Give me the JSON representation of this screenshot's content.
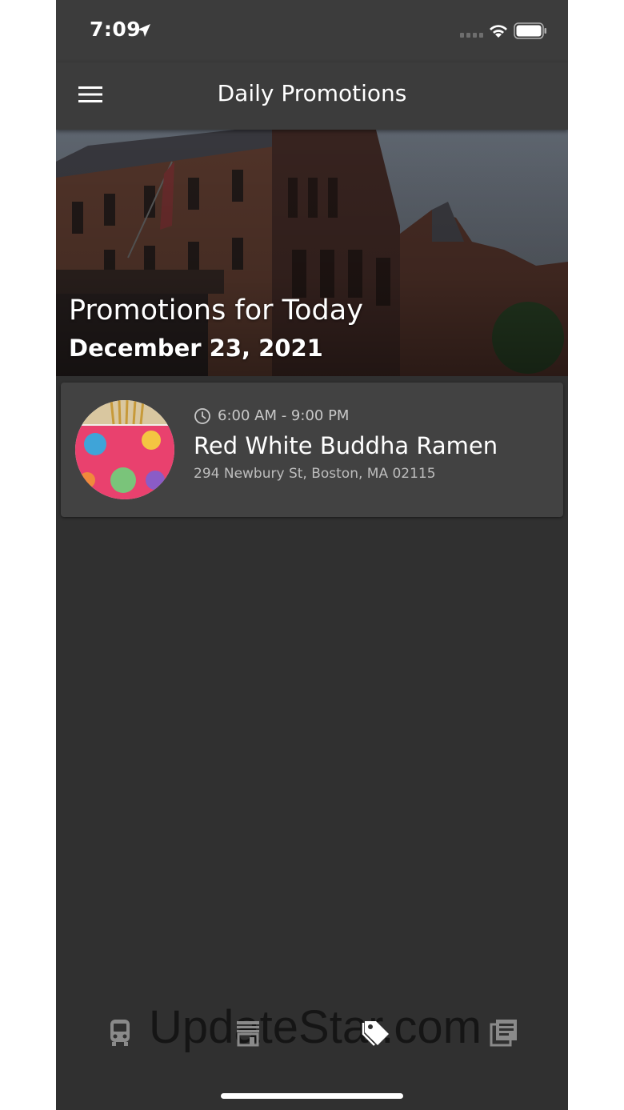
{
  "status_bar": {
    "time": "7:09",
    "location_icon": "location-arrow-icon",
    "signal_icon": "cellular-signal-icon",
    "wifi_icon": "wifi-icon",
    "battery_icon": "battery-icon"
  },
  "app_bar": {
    "title": "Daily Promotions",
    "menu_icon": "hamburger-menu-icon"
  },
  "hero": {
    "title": "Promotions for Today",
    "date": "December 23, 2021"
  },
  "promotions": [
    {
      "hours": "6:00 AM - 9:00 PM",
      "name": "Red White Buddha Ramen",
      "address": "294 Newbury St, Boston, MA 02115",
      "clock_icon": "clock-icon"
    }
  ],
  "bottom_nav": {
    "items": [
      {
        "icon": "train-icon",
        "active": false
      },
      {
        "icon": "storefront-icon",
        "active": false
      },
      {
        "icon": "tag-icon",
        "active": true
      },
      {
        "icon": "news-library-icon",
        "active": false
      }
    ],
    "active_color": "#ffffff",
    "inactive_color": "#8a8a8a"
  },
  "watermark": "UpdateStar.com",
  "colors": {
    "background": "#303030",
    "app_bar": "#3c3c3c",
    "card": "#424242"
  }
}
